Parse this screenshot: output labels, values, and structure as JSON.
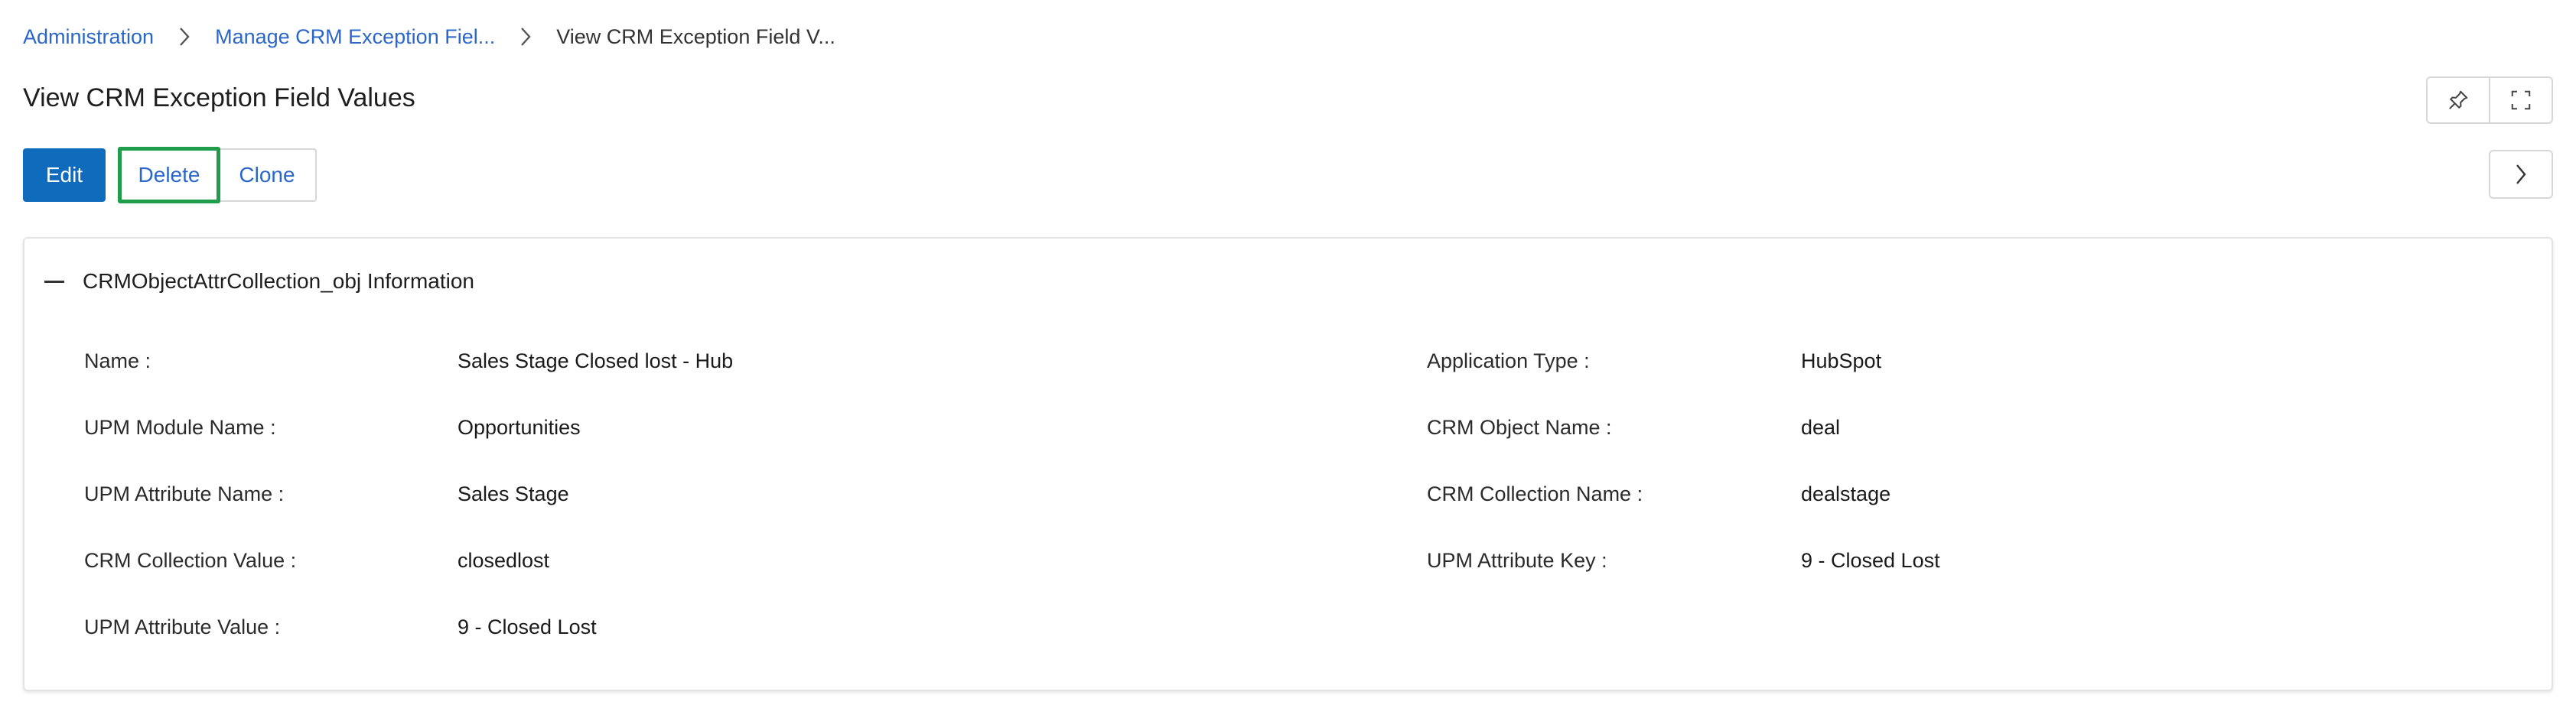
{
  "breadcrumb": {
    "items": [
      {
        "label": "Administration",
        "link": true
      },
      {
        "label": "Manage CRM Exception Fiel...",
        "link": true
      },
      {
        "label": "View CRM Exception Field V...",
        "link": false
      }
    ]
  },
  "page": {
    "title": "View CRM Exception Field Values"
  },
  "actions": {
    "edit_label": "Edit",
    "delete_label": "Delete",
    "clone_label": "Clone"
  },
  "panel": {
    "title": "CRMObjectAttrCollection_obj Information",
    "fields": [
      {
        "label": "Name :",
        "value": "Sales Stage Closed lost - Hub"
      },
      {
        "label": "Application Type :",
        "value": "HubSpot"
      },
      {
        "label": "UPM Module Name :",
        "value": "Opportunities"
      },
      {
        "label": "CRM Object Name :",
        "value": "deal"
      },
      {
        "label": "UPM Attribute Name :",
        "value": "Sales Stage"
      },
      {
        "label": "CRM Collection Name :",
        "value": "dealstage"
      },
      {
        "label": "CRM Collection Value :",
        "value": "closedlost"
      },
      {
        "label": "UPM Attribute Key :",
        "value": "9 - Closed Lost"
      },
      {
        "label": "UPM Attribute Value :",
        "value": "9 - Closed Lost"
      }
    ]
  },
  "icons": {
    "pin": "pin-icon",
    "fullscreen": "fullscreen-icon",
    "next": "chevron-right-icon",
    "breadcrumb_sep": "chevron-right-icon",
    "collapse": "minus-icon"
  },
  "colors": {
    "link": "#2b67c8",
    "primary": "#0f6cbd",
    "highlight": "#1f9d4a"
  }
}
